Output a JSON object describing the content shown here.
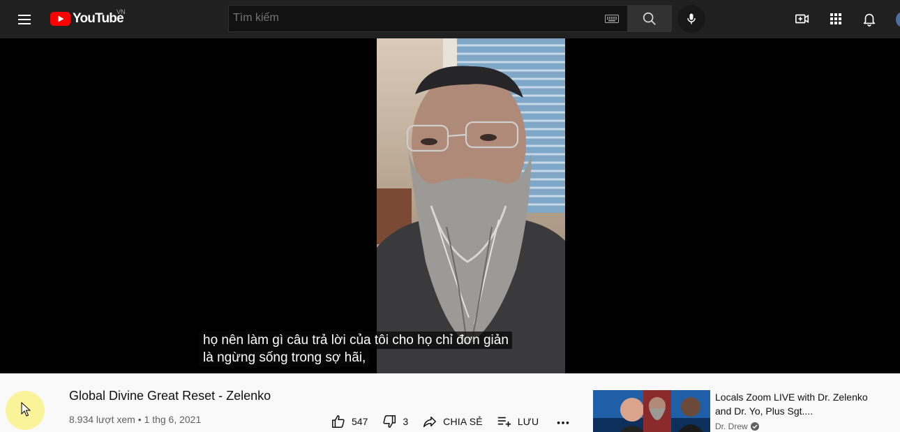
{
  "header": {
    "logo_text": "YouTube",
    "country_code": "VN",
    "search": {
      "placeholder": "Tìm kiếm",
      "value": ""
    },
    "icons": [
      "menu-icon",
      "keyboard-icon",
      "search-icon",
      "mic-icon",
      "create-video-icon",
      "apps-icon",
      "notifications-icon"
    ]
  },
  "player": {
    "caption_lines": [
      "họ nên làm gì câu trả lời của tôi cho họ chỉ đơn giản",
      "là ngừng sống trong sợ hãi,"
    ]
  },
  "video": {
    "title": "Global Divine Great Reset - Zelenko",
    "views": "8.934 lượt xem",
    "separator": "•",
    "date": "1 thg 6, 2021",
    "likes": "547",
    "dislikes": "3",
    "share_label": "CHIA SẺ",
    "save_label": "LƯU"
  },
  "related": {
    "title": "Locals Zoom LIVE with Dr. Zelenko and Dr. Yo, Plus Sgt....",
    "channel": "Dr. Drew",
    "verified": true
  },
  "colors": {
    "topbar": "#202020",
    "brand_red": "#ff0000",
    "page_bg": "#f9f9f9",
    "text_primary": "#0f0f0f",
    "text_secondary": "#606060"
  }
}
